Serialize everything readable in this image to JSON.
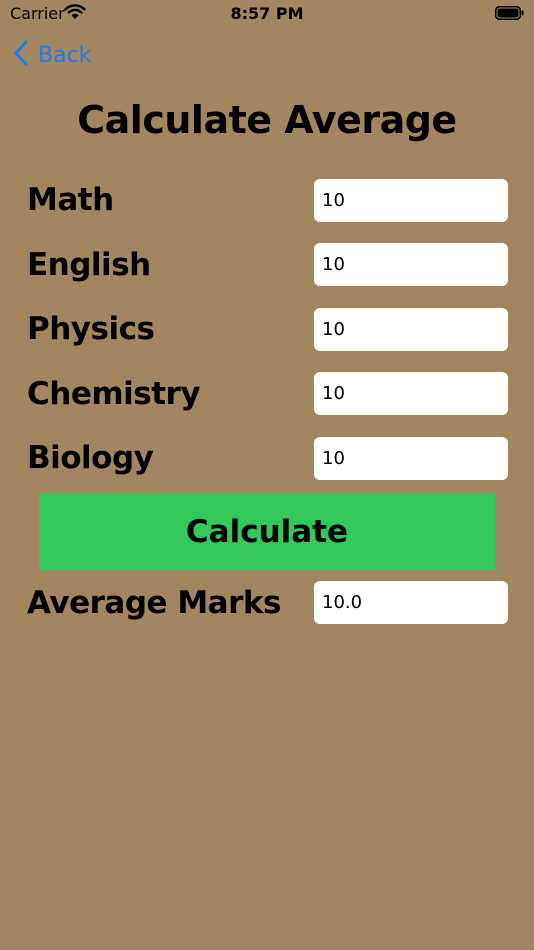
{
  "status_bar": {
    "carrier": "Carrier",
    "time": "8:57 PM"
  },
  "nav": {
    "back_label": "Back"
  },
  "title": "Calculate Average",
  "subjects": [
    {
      "label": "Math",
      "value": "10"
    },
    {
      "label": "English",
      "value": "10"
    },
    {
      "label": "Physics",
      "value": "10"
    },
    {
      "label": "Chemistry",
      "value": "10"
    },
    {
      "label": "Biology",
      "value": "10"
    }
  ],
  "calculate_label": "Calculate",
  "result": {
    "label": "Average Marks",
    "value": "10.0"
  },
  "colors": {
    "background": "#A2865F",
    "button": "#34C85A",
    "link": "#1E7CF0"
  }
}
